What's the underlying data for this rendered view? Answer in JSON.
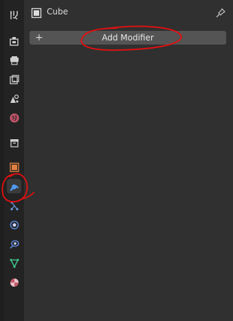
{
  "object": {
    "name": "Cube",
    "icon": "object-data-icon",
    "pin_icon": "pin-icon"
  },
  "modifier": {
    "add_label": "Add Modifier",
    "plus_glyph": "+"
  },
  "tabs": [
    {
      "name": "tool",
      "icon": "tool-settings-icon"
    },
    {
      "name": "render",
      "icon": "render-icon"
    },
    {
      "name": "output",
      "icon": "output-icon"
    },
    {
      "name": "view-layer",
      "icon": "view-layer-icon"
    },
    {
      "name": "scene",
      "icon": "scene-icon"
    },
    {
      "name": "world",
      "icon": "world-icon"
    },
    {
      "name": "collection",
      "icon": "collection-icon"
    },
    {
      "name": "object",
      "icon": "object-icon"
    },
    {
      "name": "modifiers",
      "icon": "wrench-icon",
      "active": true
    },
    {
      "name": "particles",
      "icon": "particles-icon"
    },
    {
      "name": "physics",
      "icon": "physics-icon"
    },
    {
      "name": "constraints",
      "icon": "constraints-icon"
    },
    {
      "name": "data",
      "icon": "mesh-data-icon"
    },
    {
      "name": "material",
      "icon": "material-icon"
    }
  ],
  "colors": {
    "panel_bg": "#303030",
    "tabbar_bg": "#232323",
    "button_bg": "#545454",
    "active_tab_icon": "#4f9df2",
    "annotation_red": "#e01010"
  }
}
